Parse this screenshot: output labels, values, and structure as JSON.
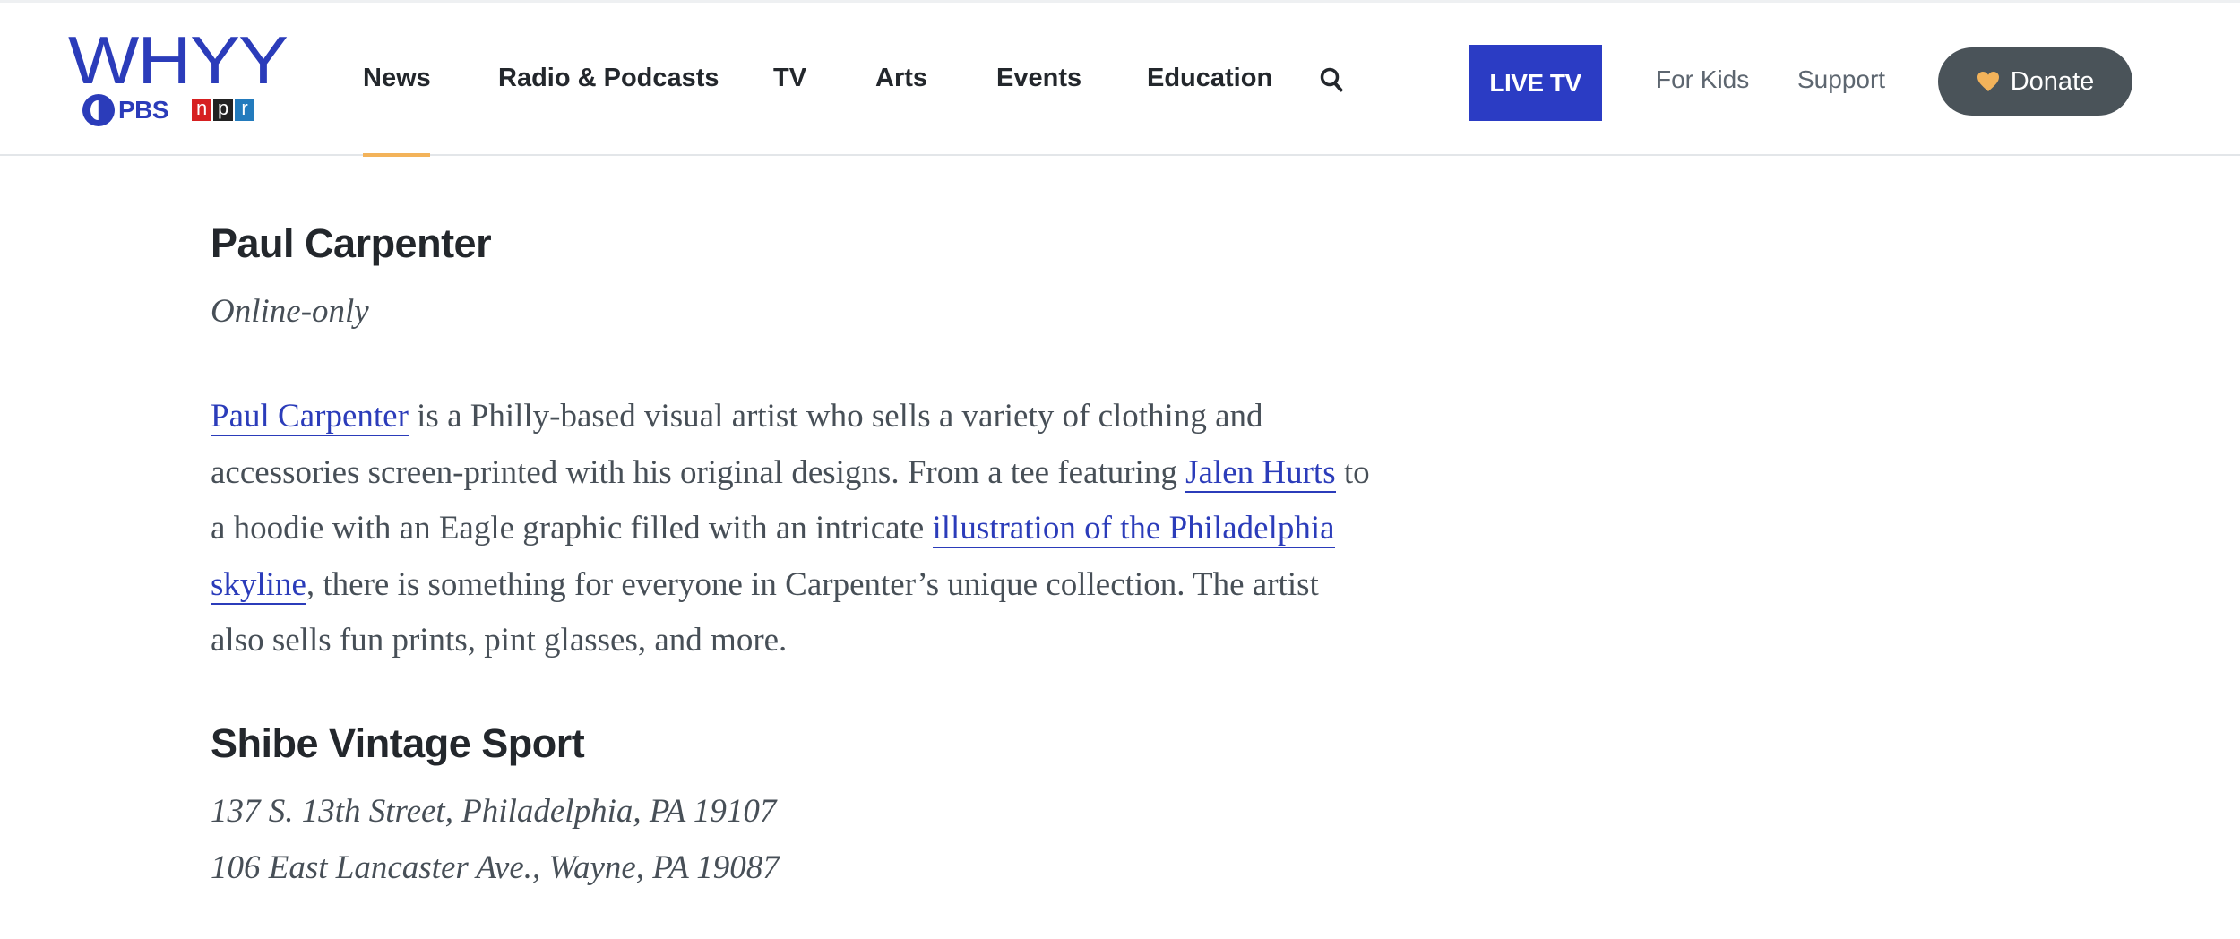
{
  "brand": {
    "name": "WHYY",
    "pbs_label": "PBS",
    "npr_letters": [
      "n",
      "p",
      "r"
    ],
    "npr_colors": [
      "#d62021",
      "#222222",
      "#237bbd"
    ],
    "primary_color": "#2b3cba"
  },
  "nav": {
    "items": [
      {
        "label": "News",
        "active": true
      },
      {
        "label": "Radio & Podcasts"
      },
      {
        "label": "TV"
      },
      {
        "label": "Arts"
      },
      {
        "label": "Events"
      },
      {
        "label": "Education"
      }
    ],
    "search_icon": "search-icon",
    "active_underline_color": "#f3b35a"
  },
  "utility": {
    "live_tv_label": "LIVE TV",
    "for_kids_label": "For Kids",
    "support_label": "Support",
    "donate_label": "Donate",
    "donate_icon": "heart-icon"
  },
  "article": {
    "entry1": {
      "title": "Paul Carpenter",
      "meta": "Online-only",
      "body": [
        {
          "type": "link",
          "text": "Paul Carpenter"
        },
        {
          "type": "text",
          "text": " is a Philly-based visual artist who sells a variety of clothing and accessories screen-printed with his original designs. From a tee featuring "
        },
        {
          "type": "link",
          "text": "Jalen Hurts"
        },
        {
          "type": "text",
          "text": " to a hoodie with an Eagle graphic filled with an intricate "
        },
        {
          "type": "link",
          "text": "illustration of the Philadelphia skyline"
        },
        {
          "type": "text",
          "text": ", there is something for everyone in Carpenter’s unique collection. The artist also sells fun prints, pint glasses, and more."
        }
      ]
    },
    "entry2": {
      "title": "Shibe Vintage Sport",
      "address1": "137 S. 13th Street, Philadelphia, PA 19107",
      "address2": "106 East Lancaster Ave., Wayne, PA 19087"
    }
  }
}
